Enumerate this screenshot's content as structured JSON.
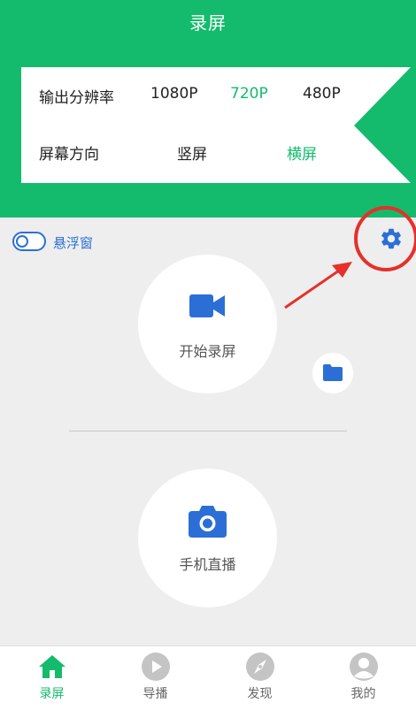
{
  "header": {
    "title": "录屏"
  },
  "settings_panel": {
    "resolution": {
      "label": "输出分辨率",
      "options": [
        "1080P",
        "720P",
        "480P"
      ],
      "selected": "720P"
    },
    "orientation": {
      "label": "屏幕方向",
      "options": [
        "竖屏",
        "横屏"
      ],
      "selected": "横屏"
    }
  },
  "floating_window": {
    "label": "悬浮窗",
    "enabled": false
  },
  "actions": {
    "start_record": "开始录屏",
    "live_stream": "手机直播"
  },
  "tabbar": [
    {
      "label": "录屏",
      "icon": "home-icon",
      "active": true
    },
    {
      "label": "导播",
      "icon": "play-icon",
      "active": false
    },
    {
      "label": "发现",
      "icon": "compass-icon",
      "active": false
    },
    {
      "label": "我的",
      "icon": "user-icon",
      "active": false
    }
  ],
  "colors": {
    "brand_green": "#14bb6c",
    "accent_blue": "#2b6fd6",
    "annotation_red": "#e5302b"
  }
}
